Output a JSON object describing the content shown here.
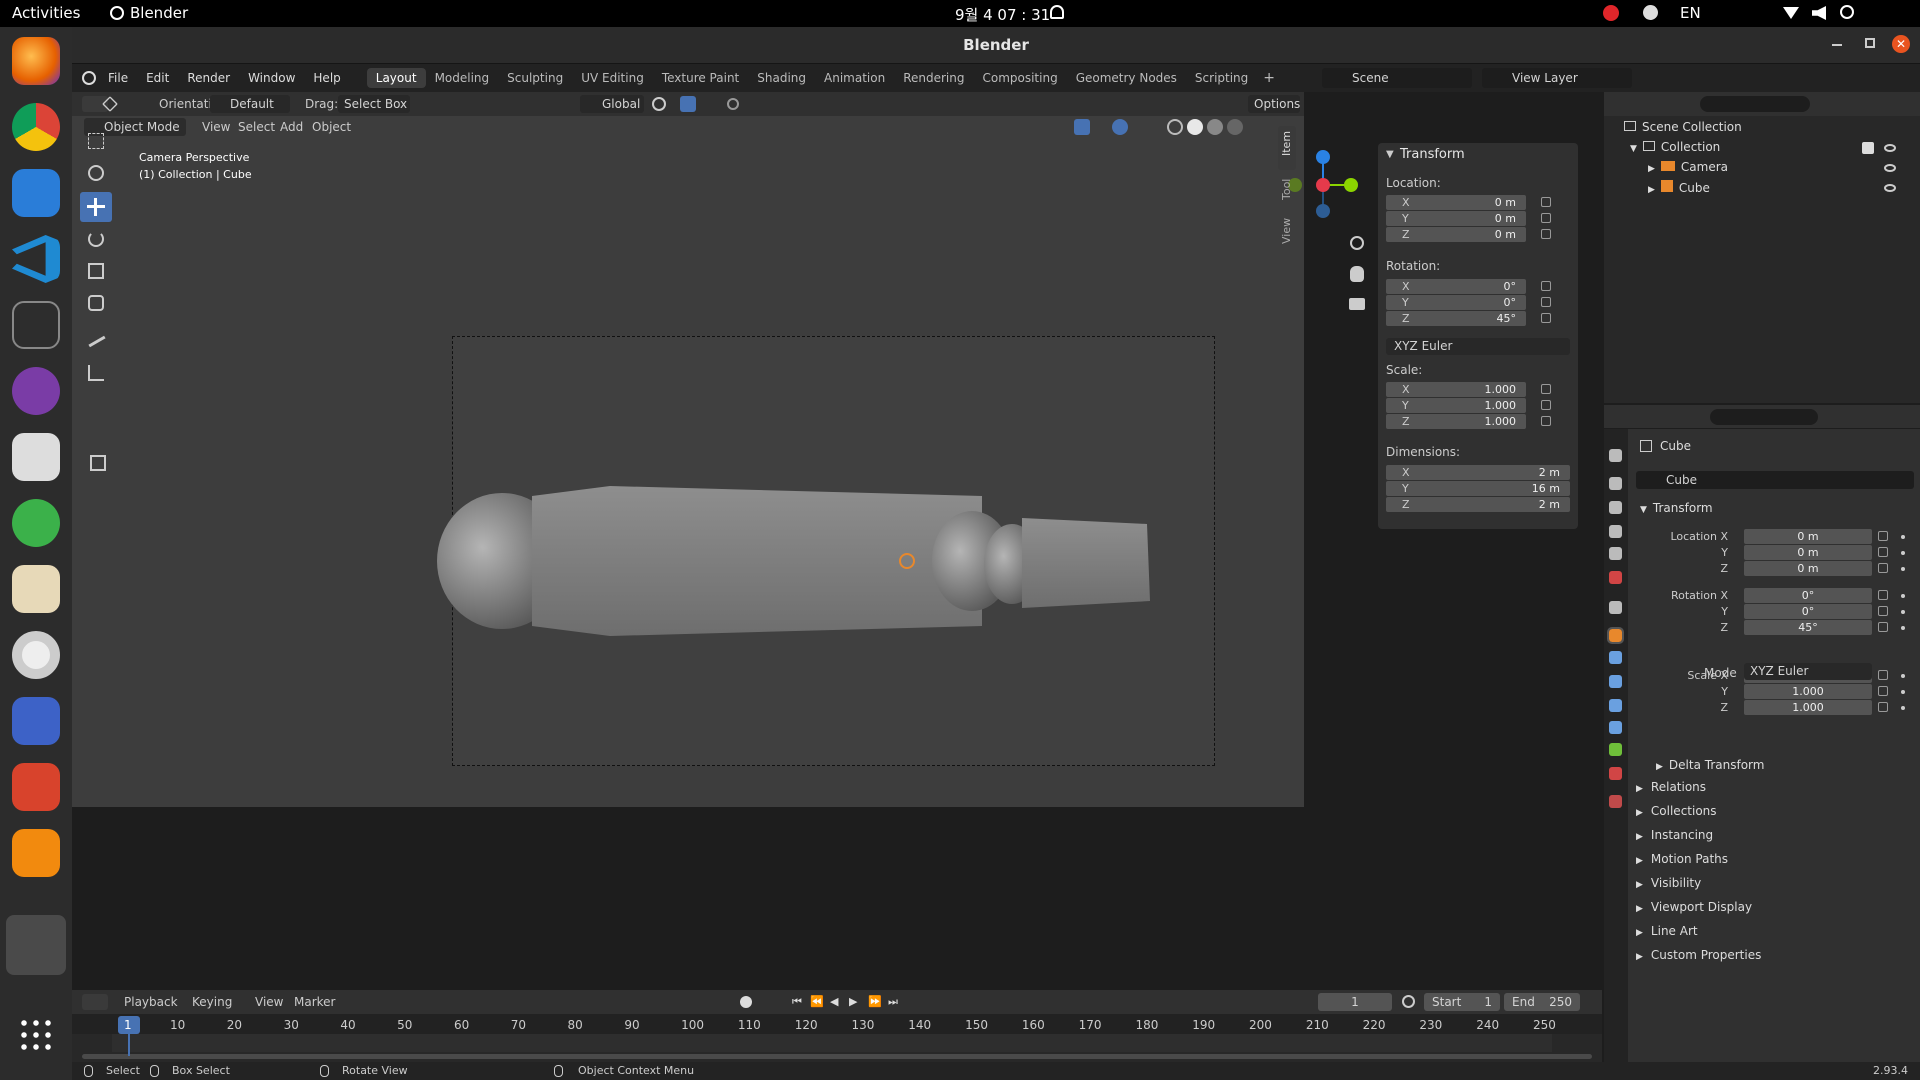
{
  "system": {
    "activities": "Activities",
    "app": "Blender",
    "clock": "9월 4 07 : 31",
    "lang": "EN"
  },
  "window": {
    "title": "Blender"
  },
  "menu": [
    "File",
    "Edit",
    "Render",
    "Window",
    "Help"
  ],
  "workspaces": [
    "Layout",
    "Modeling",
    "Sculpting",
    "UV Editing",
    "Texture Paint",
    "Shading",
    "Animation",
    "Rendering",
    "Compositing",
    "Geometry Nodes",
    "Scripting"
  ],
  "scene": {
    "label": "Scene",
    "view_layer": "View Layer"
  },
  "toolbar": {
    "orientation_label": "Orientation:",
    "orientation_value": "Default",
    "drag_label": "Drag:",
    "drag_value": "Select Box",
    "transform_space": "Global",
    "options": "Options"
  },
  "viewport_header": {
    "mode": "Object Mode",
    "items": [
      "View",
      "Select",
      "Add",
      "Object"
    ]
  },
  "viewport": {
    "camera": "Camera Perspective",
    "context": "(1) Collection | Cube"
  },
  "npanel": {
    "title": "Transform",
    "tabs": [
      "Item",
      "Tool",
      "View"
    ],
    "location_label": "Location:",
    "rotation_label": "Rotation:",
    "scale_label": "Scale:",
    "dimensions_label": "Dimensions:",
    "location": [
      {
        "a": "X",
        "v": "0 m"
      },
      {
        "a": "Y",
        "v": "0 m"
      },
      {
        "a": "Z",
        "v": "0 m"
      }
    ],
    "rotation": [
      {
        "a": "X",
        "v": "0°"
      },
      {
        "a": "Y",
        "v": "0°"
      },
      {
        "a": "Z",
        "v": "45°"
      }
    ],
    "rotation_mode": "XYZ Euler",
    "scale": [
      {
        "a": "X",
        "v": "1.000"
      },
      {
        "a": "Y",
        "v": "1.000"
      },
      {
        "a": "Z",
        "v": "1.000"
      }
    ],
    "dimensions": [
      {
        "a": "X",
        "v": "2 m"
      },
      {
        "a": "Y",
        "v": "16 m"
      },
      {
        "a": "Z",
        "v": "2 m"
      }
    ]
  },
  "outliner": {
    "root": "Scene Collection",
    "collection": "Collection",
    "items": [
      "Camera",
      "Cube"
    ]
  },
  "properties": {
    "object": "Cube",
    "datablock": "Cube",
    "transform": "Transform",
    "location_labels": [
      "Location X",
      "Y",
      "Z"
    ],
    "location": [
      "0 m",
      "0 m",
      "0 m"
    ],
    "rotation_labels": [
      "Rotation X",
      "Y",
      "Z"
    ],
    "rotation": [
      "0°",
      "0°",
      "45°"
    ],
    "mode_label": "Mode",
    "mode": "XYZ Euler",
    "scale_labels": [
      "Scale X",
      "Y",
      "Z"
    ],
    "scale": [
      "1.000",
      "1.000",
      "1.000"
    ],
    "delta": "Delta Transform",
    "sections": [
      "Relations",
      "Collections",
      "Instancing",
      "Motion Paths",
      "Visibility",
      "Viewport Display",
      "Line Art",
      "Custom Properties"
    ]
  },
  "timeline": {
    "menus": [
      "Playback",
      "Keying",
      "View",
      "Marker"
    ],
    "current": "1",
    "start_label": "Start",
    "start": "1",
    "end_label": "End",
    "end": "250",
    "ticks": [
      "1",
      "10",
      "20",
      "30",
      "40",
      "50",
      "60",
      "70",
      "80",
      "90",
      "100",
      "110",
      "120",
      "130",
      "140",
      "150",
      "160",
      "170",
      "180",
      "190",
      "200",
      "210",
      "220",
      "230",
      "240",
      "250"
    ]
  },
  "status": {
    "select": "Select",
    "box_select": "Box Select",
    "rotate": "Rotate View",
    "context": "Object Context Menu",
    "version": "2.93.4"
  },
  "colors": {
    "accent": "#4772b3",
    "active_ws": "#3d3d3d",
    "object_orange": "#e8882c"
  }
}
